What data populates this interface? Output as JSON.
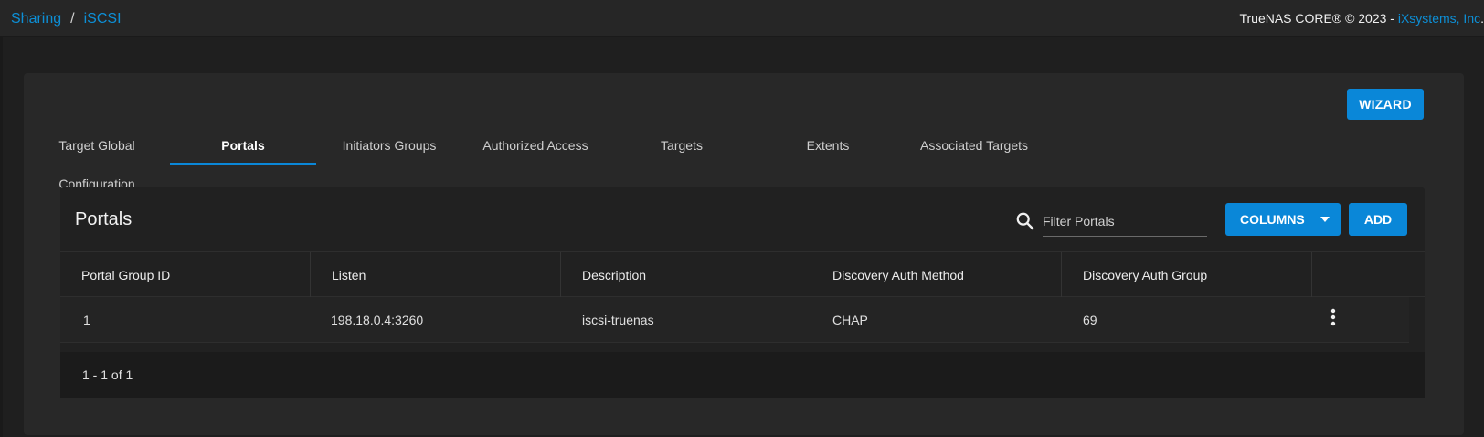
{
  "breadcrumb": {
    "first": "Sharing",
    "separator": "/",
    "second": "iSCSI"
  },
  "copyright": {
    "text": "TrueNAS CORE® © 2023 - ",
    "link": "iXsystems, Inc",
    "suffix": "."
  },
  "wizard_label": "WIZARD",
  "tabs": [
    {
      "label": "Target Global Configuration"
    },
    {
      "label": "Portals"
    },
    {
      "label": "Initiators Groups"
    },
    {
      "label": "Authorized Access"
    },
    {
      "label": "Targets"
    },
    {
      "label": "Extents"
    },
    {
      "label": "Associated Targets"
    }
  ],
  "table": {
    "title": "Portals",
    "filter_placeholder": "Filter Portals",
    "columns_label": "COLUMNS",
    "add_label": "ADD",
    "headers": [
      "Portal Group ID",
      "Listen",
      "Description",
      "Discovery Auth Method",
      "Discovery Auth Group"
    ],
    "rows": [
      [
        "1",
        "198.18.0.4:3260",
        "iscsi-truenas",
        "CHAP",
        "69"
      ]
    ],
    "pagination": "1 - 1 of 1"
  },
  "colors": {
    "accent": "#0a87d8",
    "background": "#1f1f1f",
    "card": "#282828"
  },
  "icons": {
    "search": "search-icon",
    "caret": "caret-down-icon",
    "menu": "more-vert-icon"
  }
}
